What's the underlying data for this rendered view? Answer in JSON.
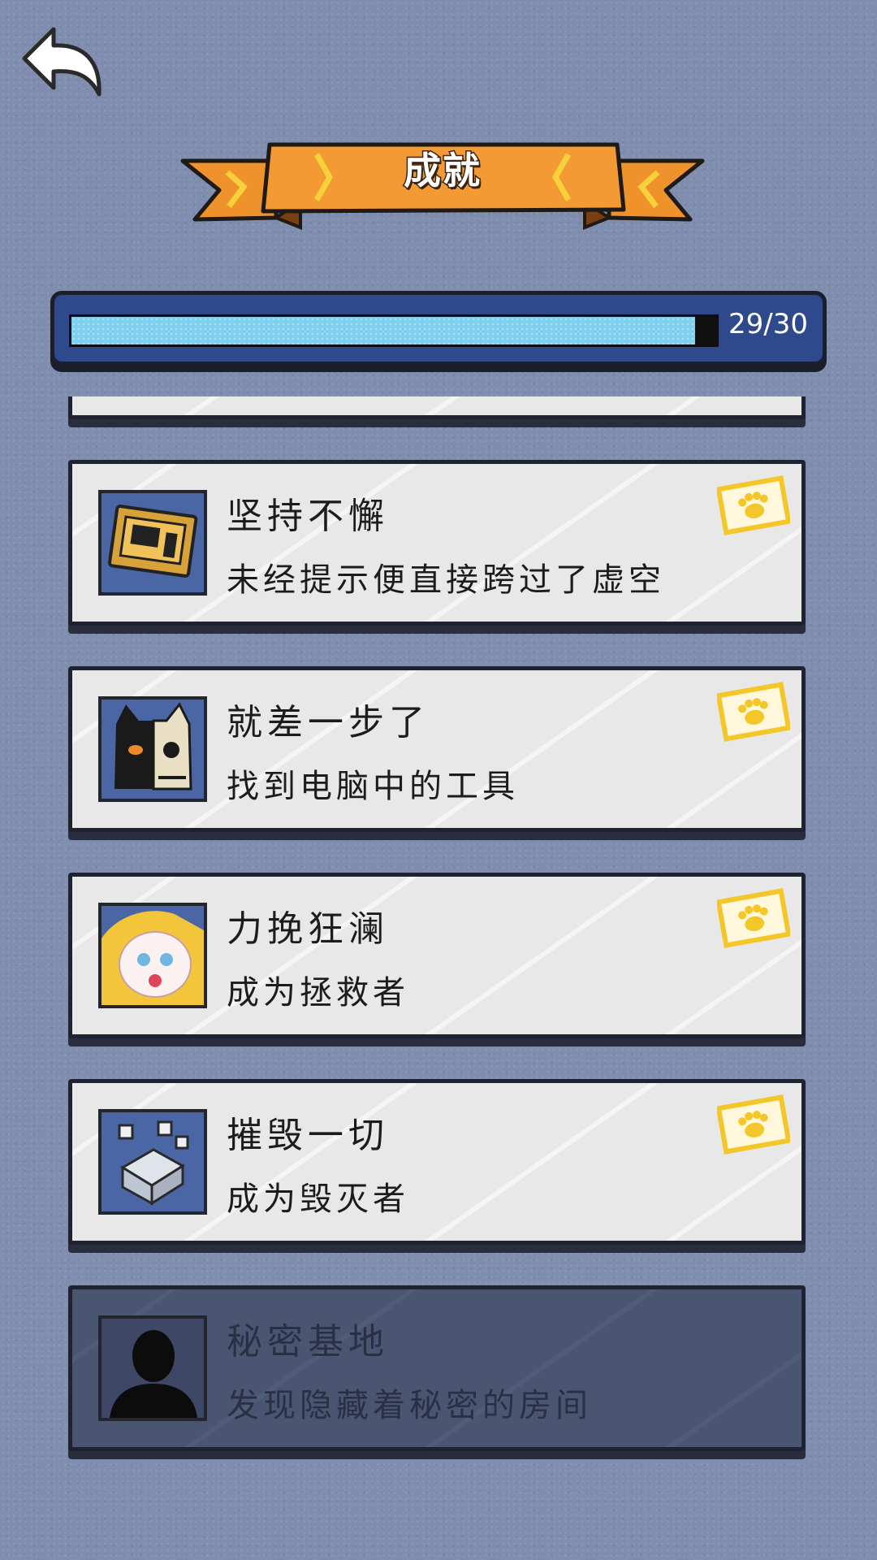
{
  "header": {
    "title": "成就"
  },
  "progress": {
    "unlocked": 29,
    "total": 30,
    "label": "29/30"
  },
  "achievements": [
    {
      "title": "坚持不懈",
      "description": "未经提示便直接跨过了虚空",
      "unlocked": true,
      "icon": "computer-icon"
    },
    {
      "title": "就差一步了",
      "description": "找到电脑中的工具",
      "unlocked": true,
      "icon": "skull-cat-icon"
    },
    {
      "title": "力挽狂澜",
      "description": "成为拯救者",
      "unlocked": true,
      "icon": "baby-cat-icon"
    },
    {
      "title": "摧毁一切",
      "description": "成为毁灭者",
      "unlocked": true,
      "icon": "cubes-icon"
    },
    {
      "title": "秘密基地",
      "description": "发现隐藏着秘密的房间",
      "unlocked": false,
      "icon": "silhouette-icon"
    }
  ],
  "colors": {
    "background": "#7f8dae",
    "banner": "#f0922c",
    "progress_frame": "#2e4a8c",
    "progress_fill": "#7fd0ef",
    "card": "#e8e8e8",
    "card_locked": "#4a5572",
    "badge": "#f3c62a"
  }
}
